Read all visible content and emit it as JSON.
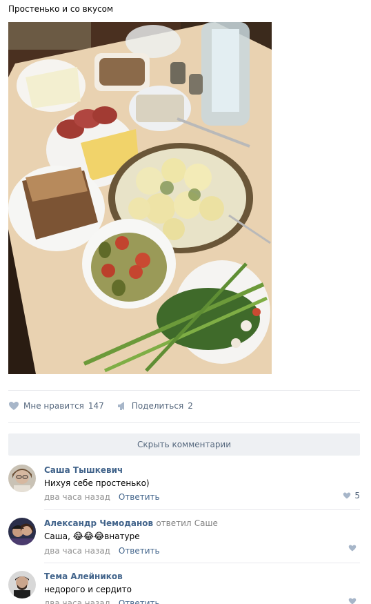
{
  "post": {
    "text": "Простенько и со вкусом"
  },
  "actions": {
    "like_label": "Мне нравится",
    "like_count": "147",
    "share_label": "Поделиться",
    "share_count": "2"
  },
  "comments_toggle": "Скрыть комментарии",
  "comments": [
    {
      "author": "Саша Тышкевич",
      "text": "Нихуя себе простенько)",
      "time": "два часа назад",
      "reply_label": "Ответить",
      "likes": "5"
    },
    {
      "author": "Александр Чемоданов",
      "reply_prefix": "ответил",
      "reply_to": "Саше",
      "text_prefix": "Саша,",
      "emoji": "😂😂😂",
      "text_suffix": "внатуре",
      "time": "два часа назад",
      "reply_label": "Ответить",
      "likes": ""
    },
    {
      "author": "Тема Алейников",
      "text": "недорого и сердито",
      "time": "два часа назад",
      "reply_label": "Ответить",
      "likes": ""
    }
  ],
  "colors": {
    "link": "#42648b",
    "muted": "#939393",
    "action": "#55677d",
    "divider": "#e7e8ec",
    "button_bg": "#eef0f3"
  },
  "icons": {
    "like": "heart-icon",
    "share": "megaphone-icon"
  }
}
